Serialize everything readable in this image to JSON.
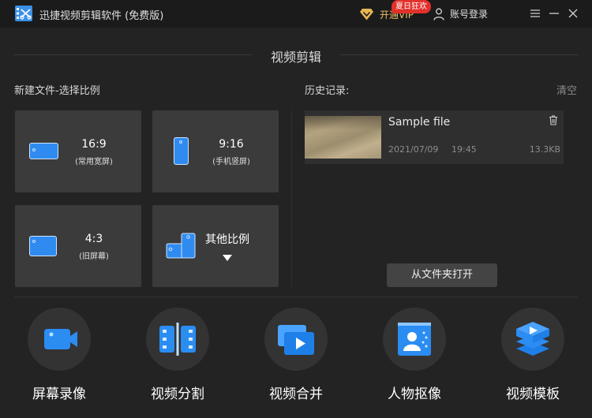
{
  "window": {
    "title": "迅捷视频剪辑软件 (免费版)",
    "vip_label": "开通VIP",
    "vip_badge": "夏日狂欢",
    "login_label": "账号登录",
    "icons": [
      "app-logo-icon",
      "vip-diamond-icon",
      "user-icon",
      "menu-icon",
      "minimize-icon",
      "close-icon"
    ]
  },
  "section_title": "视频剪辑",
  "new_file": {
    "label": "新建文件-选择比例",
    "ratios": [
      {
        "ratio": "16:9",
        "desc": "(常用宽屏)",
        "icon": "widescreen-icon"
      },
      {
        "ratio": "9:16",
        "desc": "(手机竖屏)",
        "icon": "portrait-phone-icon"
      },
      {
        "ratio": "4:3",
        "desc": "(旧屏幕)",
        "icon": "old-screen-icon"
      },
      {
        "ratio": "其他比例",
        "desc": "",
        "icon": "other-ratio-icon"
      }
    ]
  },
  "history": {
    "label": "历史记录:",
    "clear_label": "清空",
    "items": [
      {
        "name": "Sample file",
        "date": "2021/07/09",
        "time": "19:45",
        "size": "13.3KB"
      }
    ],
    "open_folder_label": "从文件夹打开"
  },
  "tools": [
    {
      "label": "屏幕录像",
      "icon": "screen-record-icon"
    },
    {
      "label": "视频分割",
      "icon": "video-split-icon"
    },
    {
      "label": "视频合并",
      "icon": "video-merge-icon"
    },
    {
      "label": "人物抠像",
      "icon": "portrait-cutout-icon"
    },
    {
      "label": "视频模板",
      "icon": "video-template-icon"
    }
  ],
  "colors": {
    "accent": "#2f8bf0",
    "background": "#232323",
    "card": "#3b3b3b",
    "vip_gold": "#e8c068",
    "badge_red": "#e2302a"
  }
}
